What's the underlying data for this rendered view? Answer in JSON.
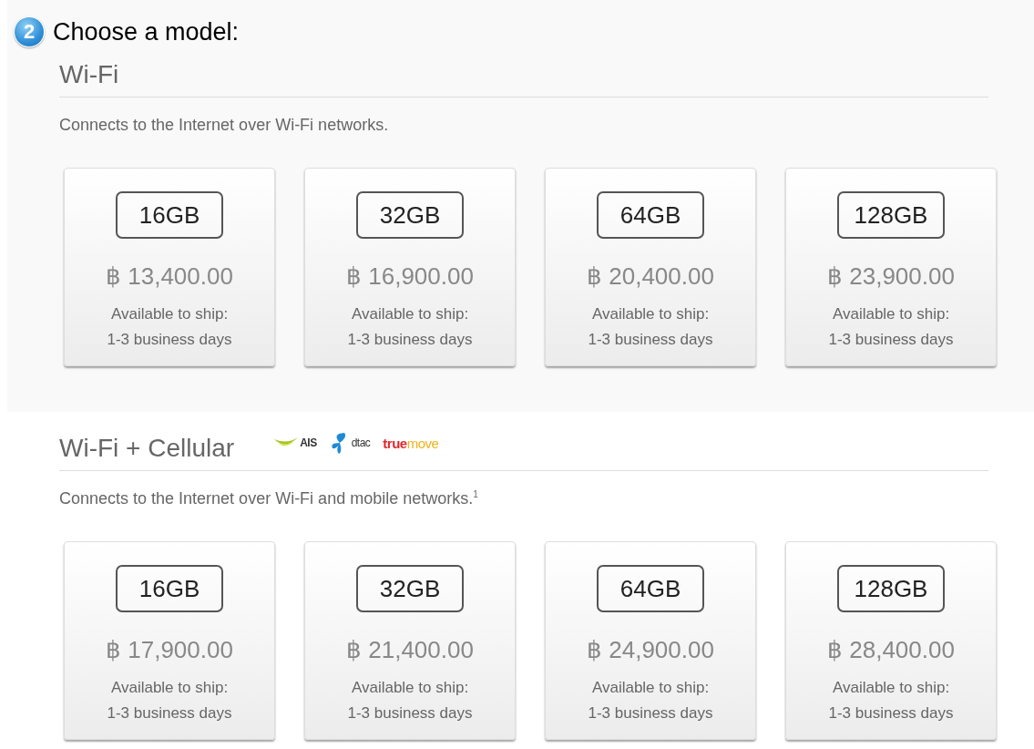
{
  "step": {
    "number": "2",
    "title": "Choose a model:"
  },
  "sections": [
    {
      "heading": "Wi-Fi",
      "description": "Connects to the Internet over Wi-Fi networks.",
      "models": [
        {
          "capacity": "16GB",
          "price": "฿ 13,400.00",
          "ship_label": "Available to ship:",
          "ship_time": "1-3 business days"
        },
        {
          "capacity": "32GB",
          "price": "฿ 16,900.00",
          "ship_label": "Available to ship:",
          "ship_time": "1-3 business days"
        },
        {
          "capacity": "64GB",
          "price": "฿ 20,400.00",
          "ship_label": "Available to ship:",
          "ship_time": "1-3 business days"
        },
        {
          "capacity": "128GB",
          "price": "฿ 23,900.00",
          "ship_label": "Available to ship:",
          "ship_time": "1-3 business days"
        }
      ]
    },
    {
      "heading": "Wi-Fi + Cellular",
      "description": "Connects to the Internet over Wi-Fi and mobile networks.$^{1}$",
      "carriers": [
        {
          "kind": "ais",
          "label": "AIS"
        },
        {
          "kind": "dtac",
          "label": "dtac"
        },
        {
          "kind": "truemove",
          "label": "true",
          "label_2": "move"
        }
      ],
      "models": [
        {
          "capacity": "16GB",
          "price": "฿ 17,900.00",
          "ship_label": "Available to ship:",
          "ship_time": "1-3 business days"
        },
        {
          "capacity": "32GB",
          "price": "฿ 21,400.00",
          "ship_label": "Available to ship:",
          "ship_time": "1-3 business days"
        },
        {
          "capacity": "64GB",
          "price": "฿ 24,900.00",
          "ship_label": "Available to ship:",
          "ship_time": "1-3 business days"
        },
        {
          "capacity": "128GB",
          "price": "฿ 28,400.00",
          "ship_label": "Available to ship:",
          "ship_time": "1-3 business days"
        }
      ]
    }
  ]
}
